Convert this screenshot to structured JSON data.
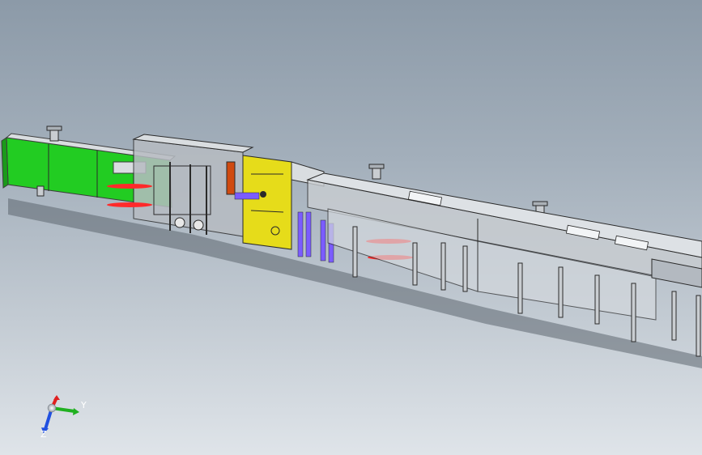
{
  "viewport": {
    "background_top": "#8c9aa8",
    "background_bottom": "#dfe4e9"
  },
  "model": {
    "colors": {
      "infeed_conveyor": "#22cc22",
      "main_frame_panel": "#e6dc1a",
      "frame_outline": "#3c3c3c",
      "rollers": "#ff2a2a",
      "actuators": "#7b5cff",
      "rails": "#c9cdd1"
    },
    "parts": [
      "infeed-conveyor",
      "mounting-knob-1",
      "mounting-knob-2",
      "mounting-knob-3",
      "mounting-knob-4",
      "forming-station",
      "yellow-side-panel",
      "red-rollers",
      "purple-cylinders",
      "outfeed-conveyor-frame",
      "support-legs"
    ]
  },
  "triad": {
    "x_color": "#e02020",
    "y_color": "#20b020",
    "z_color": "#2050e0",
    "y_label": "Y",
    "z_label": "Z"
  }
}
